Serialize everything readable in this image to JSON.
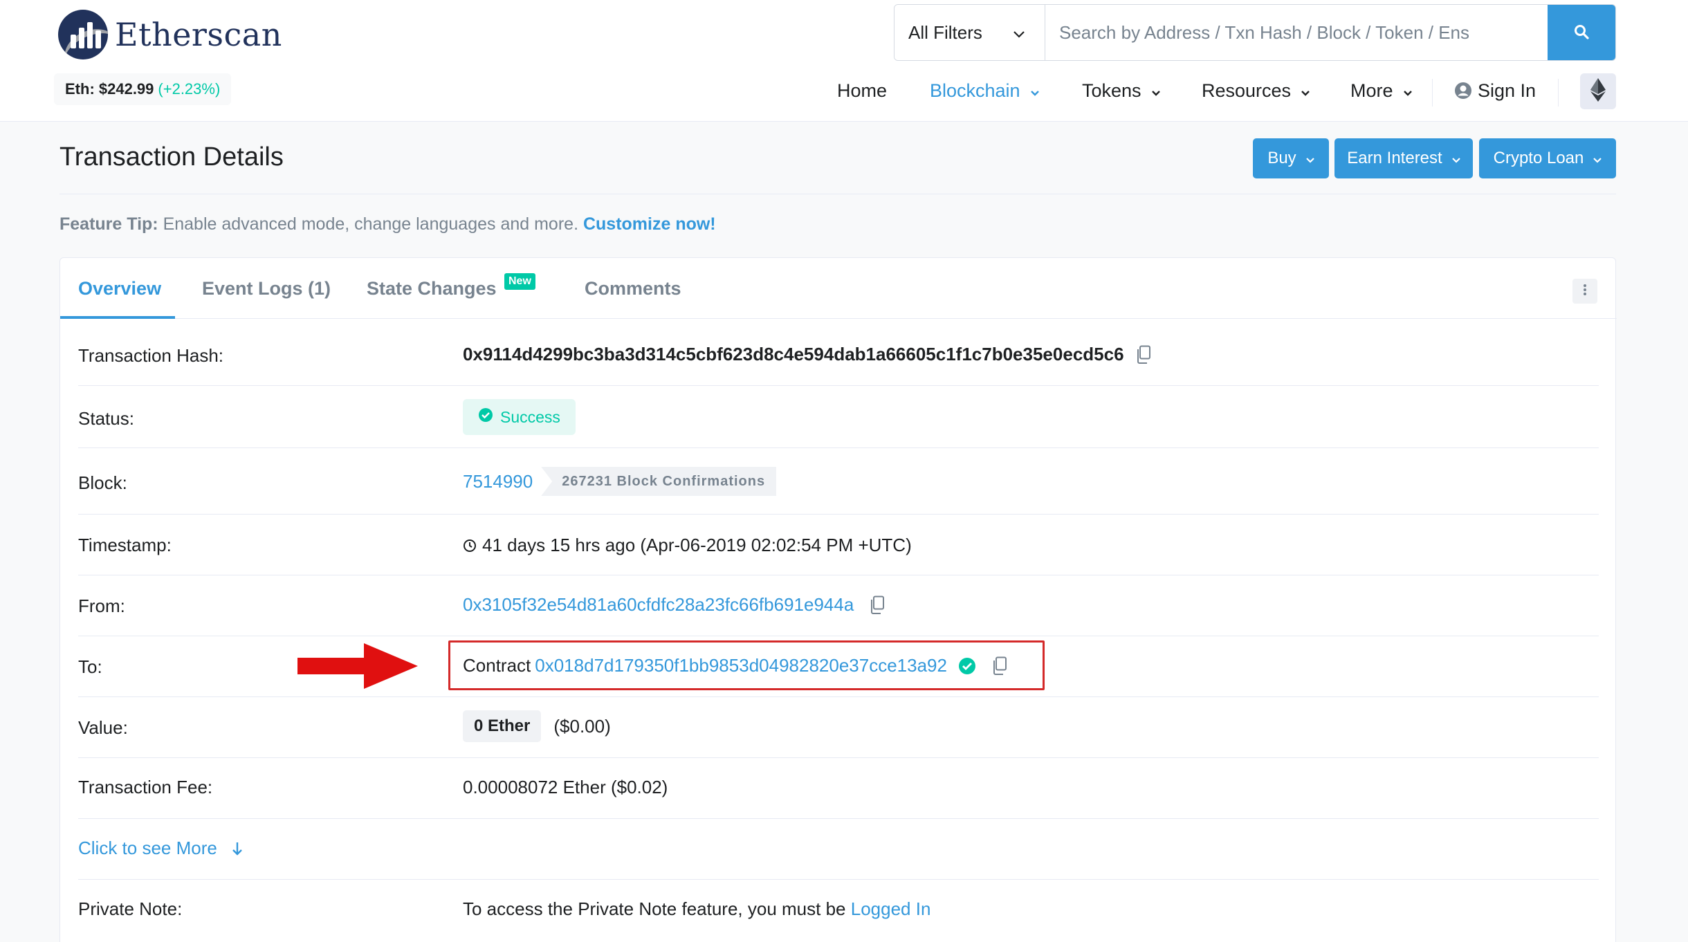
{
  "header": {
    "logo_text": "Etherscan",
    "price_label": "Eth: $242.99",
    "price_change": "(+2.23%)",
    "filter_selected": "All Filters",
    "search_placeholder": "Search by Address / Txn Hash / Block / Token / Ens",
    "nav": {
      "home": "Home",
      "blockchain": "Blockchain",
      "tokens": "Tokens",
      "resources": "Resources",
      "more": "More",
      "sign_in": "Sign In"
    },
    "icons": [
      "logo-icon",
      "chevron-down-icon",
      "search-icon",
      "user-circle-icon",
      "ethereum-icon"
    ]
  },
  "title_bar": {
    "title": "Transaction Details",
    "buttons": {
      "buy": "Buy",
      "earn": "Earn Interest",
      "loan": "Crypto Loan"
    }
  },
  "feature_tip": {
    "label": "Feature Tip:",
    "text": " Enable advanced mode, change languages and more. ",
    "link": "Customize now!"
  },
  "tabs": {
    "overview": "Overview",
    "event_logs": "Event Logs (1)",
    "state_changes": "State Changes",
    "new_badge": "New",
    "comments": "Comments"
  },
  "details": {
    "tx_hash_label": "Transaction Hash:",
    "tx_hash": "0x9114d4299bc3ba3d314c5cbf623d8c4e594dab1a66605c1f1c7b0e35e0ecd5c6",
    "status_label": "Status:",
    "status": "Success",
    "block_label": "Block:",
    "block": "7514990",
    "confirmations": "267231 Block Confirmations",
    "timestamp_label": "Timestamp:",
    "timestamp": "41 days 15 hrs ago (Apr-06-2019 02:02:54 PM +UTC)",
    "from_label": "From:",
    "from": "0x3105f32e54d81a60cfdfc28a23fc66fb691e944a",
    "to_label": "To:",
    "to_prefix": "Contract",
    "to": "0x018d7d179350f1bb9853d04982820e37cce13a92",
    "value_label": "Value:",
    "value_ether": "0 Ether",
    "value_usd": "($0.00)",
    "fee_label": "Transaction Fee:",
    "fee": "0.00008072 Ether ($0.02)",
    "see_more": "Click to see More",
    "private_note_label": "Private Note:",
    "private_note_text": "To access the Private Note feature, you must be ",
    "private_note_link": "Logged In"
  },
  "colors": {
    "accent": "#3498db",
    "success": "#00c9a7",
    "highlight": "#d42a2a",
    "brand": "#21325b"
  }
}
